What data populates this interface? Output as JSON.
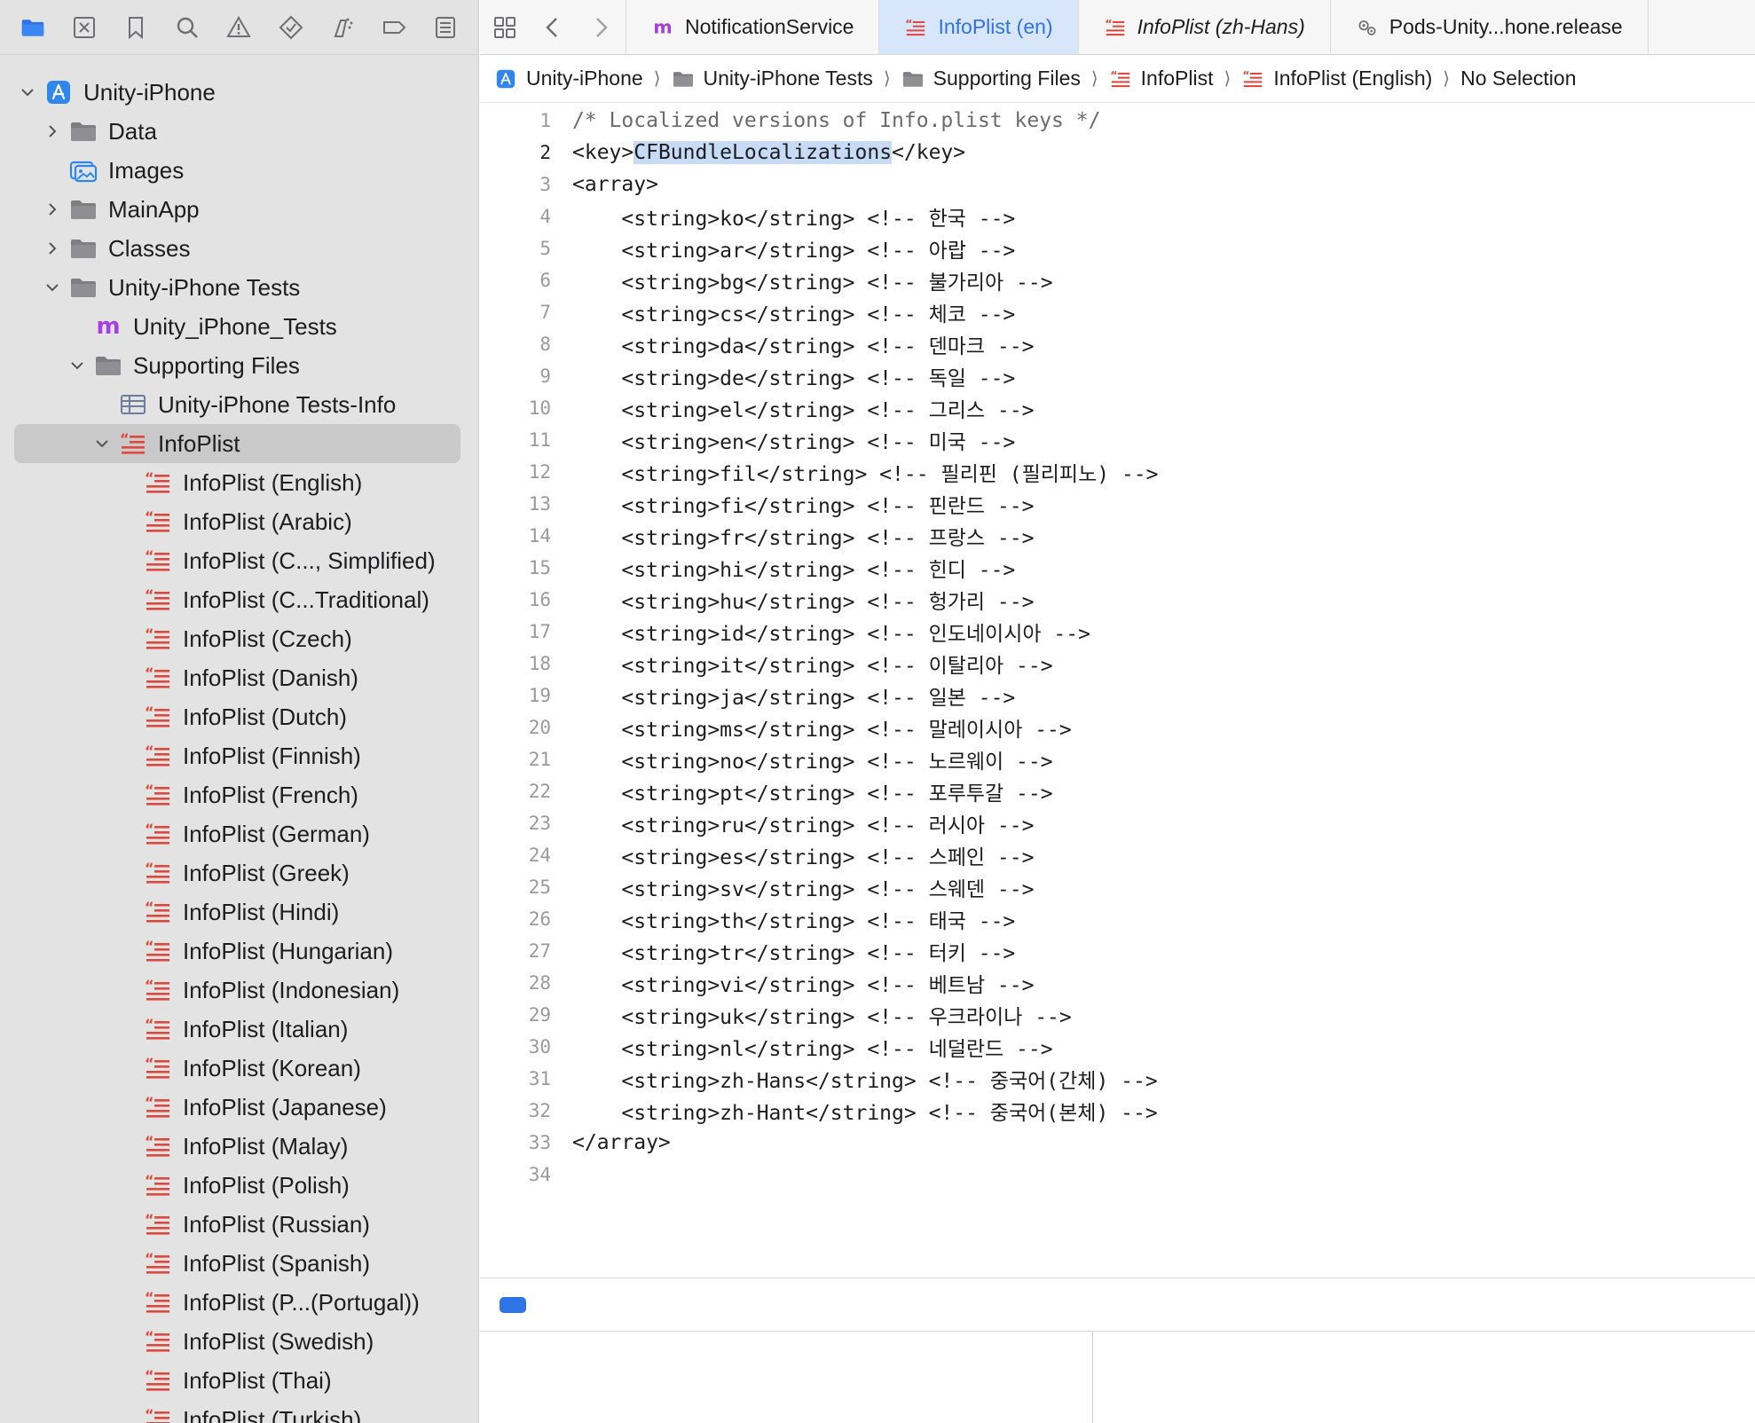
{
  "sidebar": {
    "toolbar_icons": [
      "folder-icon",
      "source-control-icon",
      "bookmark-icon",
      "find-icon",
      "issue-icon",
      "test-icon",
      "debug-icon",
      "breakpoint-icon",
      "report-icon"
    ],
    "tree": [
      {
        "label": "Unity-iPhone",
        "icon": "app-project-icon",
        "expanded": true
      },
      {
        "label": "Data",
        "icon": "folder-icon",
        "expanded": false
      },
      {
        "label": "Images",
        "icon": "asset-catalog-icon"
      },
      {
        "label": "MainApp",
        "icon": "folder-icon",
        "expanded": false
      },
      {
        "label": "Classes",
        "icon": "folder-icon",
        "expanded": false
      },
      {
        "label": "Unity-iPhone Tests",
        "icon": "folder-icon",
        "expanded": true
      },
      {
        "label": "Unity_iPhone_Tests",
        "icon": "objc-m-file-icon"
      },
      {
        "label": "Supporting Files",
        "icon": "folder-icon",
        "expanded": true
      },
      {
        "label": "Unity-iPhone Tests-Info",
        "icon": "plist-table-icon"
      },
      {
        "label": "InfoPlist",
        "icon": "strings-file-icon",
        "expanded": true,
        "selected": true
      },
      {
        "label": "InfoPlist (English)",
        "icon": "strings-file-icon"
      },
      {
        "label": "InfoPlist (Arabic)",
        "icon": "strings-file-icon"
      },
      {
        "label": "InfoPlist (C..., Simplified)",
        "icon": "strings-file-icon"
      },
      {
        "label": "InfoPlist (C...Traditional)",
        "icon": "strings-file-icon"
      },
      {
        "label": "InfoPlist (Czech)",
        "icon": "strings-file-icon"
      },
      {
        "label": "InfoPlist (Danish)",
        "icon": "strings-file-icon"
      },
      {
        "label": "InfoPlist (Dutch)",
        "icon": "strings-file-icon"
      },
      {
        "label": "InfoPlist (Finnish)",
        "icon": "strings-file-icon"
      },
      {
        "label": "InfoPlist (French)",
        "icon": "strings-file-icon"
      },
      {
        "label": "InfoPlist (German)",
        "icon": "strings-file-icon"
      },
      {
        "label": "InfoPlist (Greek)",
        "icon": "strings-file-icon"
      },
      {
        "label": "InfoPlist (Hindi)",
        "icon": "strings-file-icon"
      },
      {
        "label": "InfoPlist (Hungarian)",
        "icon": "strings-file-icon"
      },
      {
        "label": "InfoPlist (Indonesian)",
        "icon": "strings-file-icon"
      },
      {
        "label": "InfoPlist (Italian)",
        "icon": "strings-file-icon"
      },
      {
        "label": "InfoPlist (Korean)",
        "icon": "strings-file-icon"
      },
      {
        "label": "InfoPlist (Japanese)",
        "icon": "strings-file-icon"
      },
      {
        "label": "InfoPlist (Malay)",
        "icon": "strings-file-icon"
      },
      {
        "label": "InfoPlist (Polish)",
        "icon": "strings-file-icon"
      },
      {
        "label": "InfoPlist (Russian)",
        "icon": "strings-file-icon"
      },
      {
        "label": "InfoPlist (Spanish)",
        "icon": "strings-file-icon"
      },
      {
        "label": "InfoPlist (P...(Portugal))",
        "icon": "strings-file-icon"
      },
      {
        "label": "InfoPlist (Swedish)",
        "icon": "strings-file-icon"
      },
      {
        "label": "InfoPlist (Thai)",
        "icon": "strings-file-icon"
      },
      {
        "label": "InfoPlist (Turkish)",
        "icon": "strings-file-icon"
      }
    ]
  },
  "tabs": [
    {
      "label": "NotificationService",
      "icon": "objc-m-file-icon",
      "active": false,
      "italic": false
    },
    {
      "label": "InfoPlist (en)",
      "icon": "strings-file-icon",
      "active": true,
      "italic": false
    },
    {
      "label": "InfoPlist (zh-Hans)",
      "icon": "strings-file-icon",
      "active": false,
      "italic": true
    },
    {
      "label": "Pods-Unity...hone.release",
      "icon": "xcconfig-gears-icon",
      "active": false,
      "italic": false
    }
  ],
  "breadcrumb": [
    {
      "label": "Unity-iPhone",
      "icon": "app-project-icon"
    },
    {
      "label": "Unity-iPhone Tests",
      "icon": "folder-icon"
    },
    {
      "label": "Supporting Files",
      "icon": "folder-icon"
    },
    {
      "label": "InfoPlist",
      "icon": "strings-file-icon"
    },
    {
      "label": "InfoPlist (English)",
      "icon": "strings-file-icon"
    },
    {
      "label": "No Selection",
      "icon": ""
    }
  ],
  "code": {
    "current_line": 2,
    "highlight": "CFBundleLocalizations",
    "lines": [
      "/* Localized versions of Info.plist keys */",
      "<key>CFBundleLocalizations</key>",
      "<array>",
      "    <string>ko</string> <!-- 한국 -->",
      "    <string>ar</string> <!-- 아랍 -->",
      "    <string>bg</string> <!-- 불가리아 -->",
      "    <string>cs</string> <!-- 체코 -->",
      "    <string>da</string> <!-- 덴마크 -->",
      "    <string>de</string> <!-- 독일 -->",
      "    <string>el</string> <!-- 그리스 -->",
      "    <string>en</string> <!-- 미국 -->",
      "    <string>fil</string> <!-- 필리핀 (필리피노) -->",
      "    <string>fi</string> <!-- 핀란드 -->",
      "    <string>fr</string> <!-- 프랑스 -->",
      "    <string>hi</string> <!-- 힌디 -->",
      "    <string>hu</string> <!-- 헝가리 -->",
      "    <string>id</string> <!-- 인도네이시아 -->",
      "    <string>it</string> <!-- 이탈리아 -->",
      "    <string>ja</string> <!-- 일본 -->",
      "    <string>ms</string> <!-- 말레이시아 -->",
      "    <string>no</string> <!-- 노르웨이 -->",
      "    <string>pt</string> <!-- 포루투갈 -->",
      "    <string>ru</string> <!-- 러시아 -->",
      "    <string>es</string> <!-- 스페인 -->",
      "    <string>sv</string> <!-- 스웨덴 -->",
      "    <string>th</string> <!-- 태국 -->",
      "    <string>tr</string> <!-- 터키 -->",
      "    <string>vi</string> <!-- 베트남 -->",
      "    <string>uk</string> <!-- 우크라이나 -->",
      "    <string>nl</string> <!-- 네덜란드 -->",
      "    <string>zh-Hans</string> <!-- 중국어(간체) -->",
      "    <string>zh-Hant</string> <!-- 중국어(본체) -->",
      "</array>",
      ""
    ]
  },
  "colors": {
    "accent": "#2f74e6",
    "strings_icon": "#e2473b",
    "folder": "#7d7d82",
    "objc_m": "#a63fe2",
    "selection_highlight": "#c7dbf6"
  }
}
